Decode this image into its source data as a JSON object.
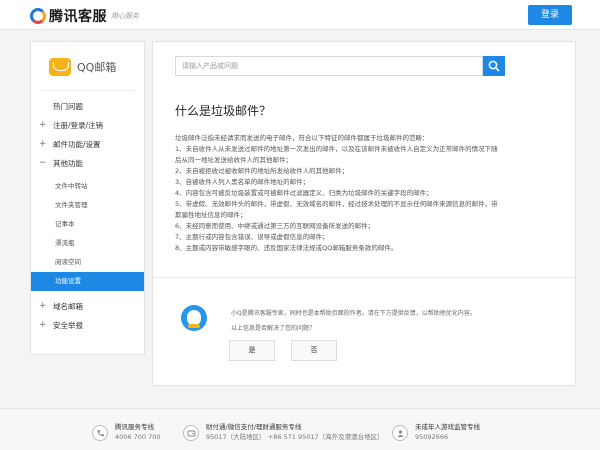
{
  "header": {
    "logo_text": "腾讯客服",
    "slogan": "用心服务",
    "login_label": "登录"
  },
  "sidebar": {
    "product_name": "QQ邮箱",
    "hot_questions": "热门问题",
    "categories": [
      {
        "sign": "+",
        "label": "注册/登录/注销"
      },
      {
        "sign": "+",
        "label": "邮件功能/设置"
      },
      {
        "sign": "−",
        "label": "其他功能"
      }
    ],
    "sub_items": [
      "文件中转站",
      "文件夹管理",
      "记事本",
      "漂流瓶",
      "阅读空间",
      "功能设置"
    ],
    "bottom_categories": [
      {
        "sign": "+",
        "label": "域名邮箱"
      },
      {
        "sign": "+",
        "label": "安全举报"
      }
    ]
  },
  "search": {
    "placeholder": "请输入产品或问题"
  },
  "article": {
    "title": "什么是垃圾邮件？",
    "lines": [
      "垃圾邮件泛指未经请求而发送的电子邮件，符合以下特征的邮件都属于垃圾邮件的范畴：",
      "1、未自收件人从未发送过邮件的地址第一次发出的邮件，以及在该邮件未被收件人自定义为正常邮件的情况下随",
      "后从同一地址发送给收件人的其他邮件；",
      "2、未自被拒收过被收邮件的地址所发给收件人的其他邮件；",
      "3、自被收件人列入黑名单的邮件地址的邮件；",
      "4、内容包含可被反垃圾装置或可被邮件过滤器定义、归类为垃圾邮件的关键字段的邮件；",
      "5、带虚假、无效邮件头的邮件，带虚假、无效域名的邮件，经过技术处理的不显示任何邮件来源信息的邮件，带",
      "欺骗性地址信息的邮件；",
      "6、未经同意而使用、中继或通过第三方的互联网设备所发送的邮件；",
      "7、主题行或内容包含错误、误导或虚假信息的邮件；",
      "8、主题或内容带敏感字眼的、违反国家法律法规或QQ邮箱服务条款的邮件。"
    ]
  },
  "feedback": {
    "description": "小Q是腾讯客服专家，同时也是本帮助页面的作者。请在下方提供反馈，以帮助他优化内容。",
    "question": "以上信息是否解决了您的问题？",
    "yes_label": "是",
    "no_label": "否"
  },
  "footer": {
    "columns": [
      {
        "title": "腾讯服务专线",
        "phone": "4006 700 700",
        "icon": "phone-icon"
      },
      {
        "title": "财付通/微信支付/理财通服务专线",
        "phone": "95017（大陆地区） +86 571 95017（海外及港澳台地区）",
        "icon": "wallet-icon"
      },
      {
        "title": "未成年人游戏监管专线",
        "phone": "95092666",
        "icon": "guardian-icon"
      }
    ]
  },
  "colors": {
    "accent": "#1e88e5",
    "mail_icon": "#f6b21b"
  }
}
